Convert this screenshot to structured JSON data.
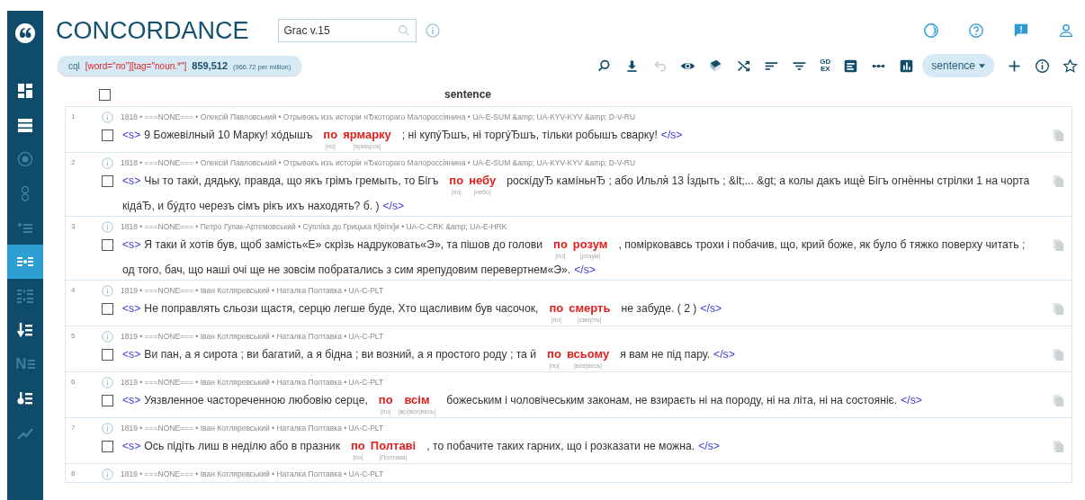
{
  "sidebar": {
    "items": [
      {
        "kind": "dashboard",
        "selected": false,
        "disabled": false
      },
      {
        "kind": "list",
        "selected": false,
        "disabled": false
      },
      {
        "kind": "target",
        "selected": false,
        "disabled": true
      },
      {
        "kind": "gear",
        "selected": false,
        "disabled": true
      },
      {
        "kind": "listdot",
        "selected": false,
        "disabled": true
      },
      {
        "kind": "concordance",
        "selected": true,
        "disabled": false
      },
      {
        "kind": "grid",
        "selected": false,
        "disabled": true
      },
      {
        "kind": "sortlist",
        "selected": false,
        "disabled": false
      },
      {
        "kind": "letter",
        "label": "N",
        "selected": false,
        "disabled": true
      },
      {
        "kind": "sortdesc",
        "selected": false,
        "disabled": false
      },
      {
        "kind": "trend",
        "selected": false,
        "disabled": true
      }
    ]
  },
  "header": {
    "title": "CONCORDANCE",
    "corpus_field": {
      "value": "Grac v.15"
    },
    "icons": [
      {
        "kind": "theme"
      },
      {
        "kind": "help"
      },
      {
        "kind": "feedback"
      },
      {
        "kind": "user"
      }
    ]
  },
  "query": {
    "label": "cql",
    "text": "[word=\"по\"][tag=\"noun.*\"]",
    "count": "859,512",
    "per_million": "(966.72 per million)"
  },
  "toolbar": [
    {
      "kind": "search",
      "disabled": false
    },
    {
      "kind": "download",
      "disabled": false
    },
    {
      "kind": "undo",
      "disabled": true
    },
    {
      "kind": "eye",
      "disabled": false
    },
    {
      "kind": "book",
      "disabled": false
    },
    {
      "kind": "shuffle",
      "disabled": false
    },
    {
      "kind": "sort",
      "disabled": false
    },
    {
      "kind": "filter",
      "disabled": false
    },
    {
      "kind": "text",
      "label": "GD EX",
      "disabled": false
    },
    {
      "kind": "doc",
      "disabled": false
    },
    {
      "kind": "dots",
      "disabled": false
    },
    {
      "kind": "bars",
      "disabled": false
    },
    {
      "kind": "dropdown",
      "label": "sentence",
      "disabled": false
    },
    {
      "kind": "plus",
      "disabled": false
    },
    {
      "kind": "info",
      "disabled": false
    },
    {
      "kind": "star",
      "disabled": false
    }
  ],
  "table": {
    "header": {
      "checked": false,
      "column": "sentence"
    },
    "rows": [
      {
        "number": "1",
        "meta": "1818 • ===NONE=== • Олексій Павловський • Отрывокъ изъ исторіи нЂкотораго Малороссіянина • UA-E-SUM &amp; UA-KYV-KYV &amp; D-V-RU",
        "checked": false,
        "open_tag": "<s>",
        "left": "9 Божевілный 10 Марку! хóдышъ",
        "keywords": [
          {
            "word": "по",
            "lemma": "|по|"
          },
          {
            "word": "ярмарку",
            "lemma": "|ярмарок|"
          }
        ],
        "right": "; ні купýЂшъ, ні торгýЂшъ, тільки робышъ сварку!",
        "close_tag": "</s>"
      },
      {
        "number": "2",
        "meta": "1818 • ===NONE=== • Олексій Павловський • Отрывокъ изъ исторіи нЂкотораго Малороссіянина • UA-E-SUM &amp; UA-KYV-KYV &amp; D-V-RU",
        "checked": false,
        "open_tag": "<s>",
        "left": "Чы то такѝ, дядьку, правда, що якъ грімъ гремыть, то Бігъ",
        "keywords": [
          {
            "word": "по",
            "lemma": "|по|"
          },
          {
            "word": "небу",
            "lemma": "|небо|"
          }
        ],
        "right": "роскíдуЂ камíньнЂ ; або Ильля̀ 13 Íздыть ; &lt;... &gt; а колы дакъ ищѐ Бігъ огнѐнны стрілки 1 на чорта",
        "right_more": "кідáЂ, и бýдто черезъ сімъ рікъ ихъ находять? б. )",
        "close_tag": "</s>"
      },
      {
        "number": "3",
        "meta": "1818 • ===NONE=== • Петро Гулак-Артемовський • Супліка до Грицька К[вітк]и • UA-C-CRK &amp; UA-E-HRK",
        "checked": false,
        "open_tag": "<s>",
        "left": "Я таки й хотів був, щоб замість«Е» скрізь надруковать«Э», та пішов до голови",
        "keywords": [
          {
            "word": "по",
            "lemma": "|по|"
          },
          {
            "word": "розум",
            "lemma": "|розум|"
          }
        ],
        "right": ", помірковавсь трохи і побачив, що, крий боже, як було б тяжко поверху читать ;",
        "right_more": "од того, бач, що наші очі ще не зовсім побратались з сим ярепудовим перевертнем«Э».",
        "close_tag": "</s>"
      },
      {
        "number": "4",
        "meta": "1819 • ===NONE=== • Іван Котляревський • Наталка Полтавка • UA-C-PLT",
        "checked": false,
        "open_tag": "<s>",
        "left": "Не поправлять сльози щастя, серцю легше буде, Хто щасливим був часочок,",
        "keywords": [
          {
            "word": "по",
            "lemma": "|по|"
          },
          {
            "word": "смерть",
            "lemma": "|смерть|"
          }
        ],
        "right": "не забуде. ( 2 )",
        "close_tag": "</s>"
      },
      {
        "number": "5",
        "meta": "1819 • ===NONE=== • Іван Котляревський • Наталка Полтавка • UA-C-PLT",
        "checked": false,
        "open_tag": "<s>",
        "left": "Ви пан, а я сирота ; ви багатий, а я бідна ; ви возний, а я простого роду ; та й",
        "keywords": [
          {
            "word": "по",
            "lemma": "|по|"
          },
          {
            "word": "всьому",
            "lemma": "|все|весь|"
          }
        ],
        "right": "я вам не під пару.",
        "close_tag": "</s>"
      },
      {
        "number": "6",
        "meta": "1819 • ===NONE=== • Іван Котляревський • Наталка Полтавка • UA-C-PLT",
        "checked": false,
        "open_tag": "<s>",
        "left": "Уязвленное частореченною любовію серце,",
        "keywords": [
          {
            "word": "по",
            "lemma": "|по|"
          },
          {
            "word": "всім",
            "lemma": "|всі|все|весь|"
          }
        ],
        "right": "божеським і чоловічеським законам, не взираєть ні на породу, ні на літа, ні на состояніє.",
        "close_tag": "</s>"
      },
      {
        "number": "7",
        "meta": "1819 • ===NONE=== • Іван Котляревський • Наталка Полтавка • UA-C-PLT",
        "checked": false,
        "open_tag": "<s>",
        "left": "Ось підіть лиш в неділю або в празник",
        "keywords": [
          {
            "word": "по",
            "lemma": "|по|"
          },
          {
            "word": "Полтаві",
            "lemma": "|Полтава|"
          }
        ],
        "right": ", то побачите таких гарних, що і розказати не можна.",
        "close_tag": "</s>"
      },
      {
        "number": "8",
        "meta": "1819 • ===NONE=== • Іван Котляревський • Наталка Полтавка • UA-C-PLT"
      }
    ]
  }
}
